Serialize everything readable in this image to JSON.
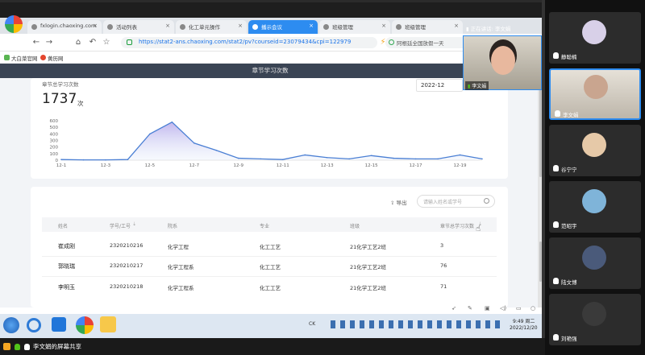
{
  "browser": {
    "tabs": [
      {
        "label": "fxlogin.chaoxing.com"
      },
      {
        "label": "活动列表"
      },
      {
        "label": "化工单元操作"
      },
      {
        "label": "播示会议"
      },
      {
        "label": "班级管理"
      },
      {
        "label": "班级管理"
      }
    ],
    "address": "https://stat2-ans.chaoxing.com/stat2/pv?courseid=23079434&cpi=122979",
    "search_hint": "阿根廷全国放假一天",
    "bookmarks": [
      "大白菜官网",
      "黄历网"
    ]
  },
  "page": {
    "header_title": "章节学习次数",
    "stat": {
      "label": "章节总学习次数",
      "value": "1737",
      "unit": "次"
    },
    "month": "2022-12",
    "export_label": "导出",
    "search_placeholder": "请输入姓名或学号",
    "table": {
      "columns": [
        "姓名",
        "学号/工号",
        "院系",
        "专业",
        "班级",
        "章节总学习次数"
      ],
      "rows": [
        {
          "name": "崔成刚",
          "id": "2320210216",
          "dept": "化学工程",
          "major": "化工工艺",
          "class": "21化学工艺2班",
          "count": "3"
        },
        {
          "name": "郭晓瑞",
          "id": "2320210217",
          "dept": "化学工程系",
          "major": "化工工艺",
          "class": "21化学工艺2班",
          "count": "76"
        },
        {
          "name": "李明玉",
          "id": "2320210218",
          "dept": "化学工程系",
          "major": "化工工艺",
          "class": "21化学工艺2班",
          "count": "71"
        }
      ]
    }
  },
  "chart_data": {
    "type": "area",
    "x": [
      "12-1",
      "12-2",
      "12-3",
      "12-4",
      "12-5",
      "12-6",
      "12-7",
      "12-8",
      "12-9",
      "12-10",
      "12-11",
      "12-12",
      "12-13",
      "12-14",
      "12-15",
      "12-16",
      "12-17",
      "12-18",
      "12-19",
      "12-20"
    ],
    "xticks": [
      "12-1",
      "12-3",
      "12-5",
      "12-7",
      "12-9",
      "12-11",
      "12-13",
      "12-15",
      "12-17",
      "12-19"
    ],
    "values": [
      10,
      5,
      5,
      10,
      400,
      580,
      260,
      150,
      30,
      20,
      10,
      80,
      40,
      20,
      70,
      30,
      20,
      20,
      80,
      20
    ],
    "yticks": [
      0,
      100,
      200,
      300,
      400,
      500,
      600
    ],
    "ylim": [
      0,
      650
    ],
    "color": "#4a7fd4",
    "grid": false
  },
  "meeting": {
    "speaking_label": "正在讲话: 李文娟",
    "self_name": "李文娟",
    "participants": [
      {
        "name": "静聪楠"
      },
      {
        "name": "李文娟"
      },
      {
        "name": "谷宁宁"
      },
      {
        "name": "范昭宇"
      },
      {
        "name": "陆文博"
      },
      {
        "name": "刘艳强"
      }
    ],
    "share_label": "李文娟的屏幕共享"
  },
  "taskbar": {
    "ime": "CK",
    "time": "9:49 周二",
    "date": "2022/12/20"
  },
  "colors": {
    "accent": "#2d8cf0",
    "header": "#3a4454",
    "chart_line": "#4a7fd4"
  }
}
